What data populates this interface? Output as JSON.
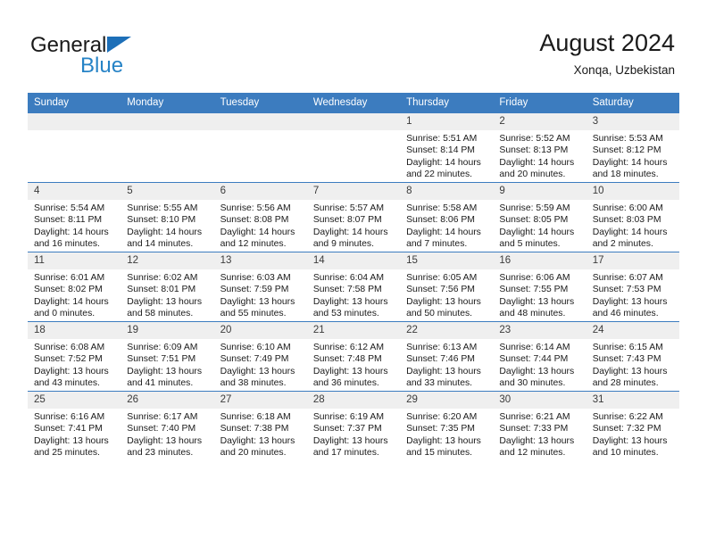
{
  "brand": {
    "name_part1": "General",
    "name_part2": "Blue",
    "accent_color": "#2683c6",
    "triangle_color": "#1d6fb8"
  },
  "header": {
    "title": "August 2024",
    "location": "Xonqa, Uzbekistan"
  },
  "theme": {
    "header_row_color": "#3c7cbf",
    "daynum_band_color": "#efefef",
    "text_color": "#1a1a1a"
  },
  "weekday_headers": [
    "Sunday",
    "Monday",
    "Tuesday",
    "Wednesday",
    "Thursday",
    "Friday",
    "Saturday"
  ],
  "weeks": [
    [
      {
        "day": "",
        "empty": true,
        "sunrise": "",
        "sunset": "",
        "daylight_line1": "",
        "daylight_line2": ""
      },
      {
        "day": "",
        "empty": true,
        "sunrise": "",
        "sunset": "",
        "daylight_line1": "",
        "daylight_line2": ""
      },
      {
        "day": "",
        "empty": true,
        "sunrise": "",
        "sunset": "",
        "daylight_line1": "",
        "daylight_line2": ""
      },
      {
        "day": "",
        "empty": true,
        "sunrise": "",
        "sunset": "",
        "daylight_line1": "",
        "daylight_line2": ""
      },
      {
        "day": "1",
        "empty": false,
        "sunrise": "Sunrise: 5:51 AM",
        "sunset": "Sunset: 8:14 PM",
        "daylight_line1": "Daylight: 14 hours",
        "daylight_line2": "and 22 minutes."
      },
      {
        "day": "2",
        "empty": false,
        "sunrise": "Sunrise: 5:52 AM",
        "sunset": "Sunset: 8:13 PM",
        "daylight_line1": "Daylight: 14 hours",
        "daylight_line2": "and 20 minutes."
      },
      {
        "day": "3",
        "empty": false,
        "sunrise": "Sunrise: 5:53 AM",
        "sunset": "Sunset: 8:12 PM",
        "daylight_line1": "Daylight: 14 hours",
        "daylight_line2": "and 18 minutes."
      }
    ],
    [
      {
        "day": "4",
        "empty": false,
        "sunrise": "Sunrise: 5:54 AM",
        "sunset": "Sunset: 8:11 PM",
        "daylight_line1": "Daylight: 14 hours",
        "daylight_line2": "and 16 minutes."
      },
      {
        "day": "5",
        "empty": false,
        "sunrise": "Sunrise: 5:55 AM",
        "sunset": "Sunset: 8:10 PM",
        "daylight_line1": "Daylight: 14 hours",
        "daylight_line2": "and 14 minutes."
      },
      {
        "day": "6",
        "empty": false,
        "sunrise": "Sunrise: 5:56 AM",
        "sunset": "Sunset: 8:08 PM",
        "daylight_line1": "Daylight: 14 hours",
        "daylight_line2": "and 12 minutes."
      },
      {
        "day": "7",
        "empty": false,
        "sunrise": "Sunrise: 5:57 AM",
        "sunset": "Sunset: 8:07 PM",
        "daylight_line1": "Daylight: 14 hours",
        "daylight_line2": "and 9 minutes."
      },
      {
        "day": "8",
        "empty": false,
        "sunrise": "Sunrise: 5:58 AM",
        "sunset": "Sunset: 8:06 PM",
        "daylight_line1": "Daylight: 14 hours",
        "daylight_line2": "and 7 minutes."
      },
      {
        "day": "9",
        "empty": false,
        "sunrise": "Sunrise: 5:59 AM",
        "sunset": "Sunset: 8:05 PM",
        "daylight_line1": "Daylight: 14 hours",
        "daylight_line2": "and 5 minutes."
      },
      {
        "day": "10",
        "empty": false,
        "sunrise": "Sunrise: 6:00 AM",
        "sunset": "Sunset: 8:03 PM",
        "daylight_line1": "Daylight: 14 hours",
        "daylight_line2": "and 2 minutes."
      }
    ],
    [
      {
        "day": "11",
        "empty": false,
        "sunrise": "Sunrise: 6:01 AM",
        "sunset": "Sunset: 8:02 PM",
        "daylight_line1": "Daylight: 14 hours",
        "daylight_line2": "and 0 minutes."
      },
      {
        "day": "12",
        "empty": false,
        "sunrise": "Sunrise: 6:02 AM",
        "sunset": "Sunset: 8:01 PM",
        "daylight_line1": "Daylight: 13 hours",
        "daylight_line2": "and 58 minutes."
      },
      {
        "day": "13",
        "empty": false,
        "sunrise": "Sunrise: 6:03 AM",
        "sunset": "Sunset: 7:59 PM",
        "daylight_line1": "Daylight: 13 hours",
        "daylight_line2": "and 55 minutes."
      },
      {
        "day": "14",
        "empty": false,
        "sunrise": "Sunrise: 6:04 AM",
        "sunset": "Sunset: 7:58 PM",
        "daylight_line1": "Daylight: 13 hours",
        "daylight_line2": "and 53 minutes."
      },
      {
        "day": "15",
        "empty": false,
        "sunrise": "Sunrise: 6:05 AM",
        "sunset": "Sunset: 7:56 PM",
        "daylight_line1": "Daylight: 13 hours",
        "daylight_line2": "and 50 minutes."
      },
      {
        "day": "16",
        "empty": false,
        "sunrise": "Sunrise: 6:06 AM",
        "sunset": "Sunset: 7:55 PM",
        "daylight_line1": "Daylight: 13 hours",
        "daylight_line2": "and 48 minutes."
      },
      {
        "day": "17",
        "empty": false,
        "sunrise": "Sunrise: 6:07 AM",
        "sunset": "Sunset: 7:53 PM",
        "daylight_line1": "Daylight: 13 hours",
        "daylight_line2": "and 46 minutes."
      }
    ],
    [
      {
        "day": "18",
        "empty": false,
        "sunrise": "Sunrise: 6:08 AM",
        "sunset": "Sunset: 7:52 PM",
        "daylight_line1": "Daylight: 13 hours",
        "daylight_line2": "and 43 minutes."
      },
      {
        "day": "19",
        "empty": false,
        "sunrise": "Sunrise: 6:09 AM",
        "sunset": "Sunset: 7:51 PM",
        "daylight_line1": "Daylight: 13 hours",
        "daylight_line2": "and 41 minutes."
      },
      {
        "day": "20",
        "empty": false,
        "sunrise": "Sunrise: 6:10 AM",
        "sunset": "Sunset: 7:49 PM",
        "daylight_line1": "Daylight: 13 hours",
        "daylight_line2": "and 38 minutes."
      },
      {
        "day": "21",
        "empty": false,
        "sunrise": "Sunrise: 6:12 AM",
        "sunset": "Sunset: 7:48 PM",
        "daylight_line1": "Daylight: 13 hours",
        "daylight_line2": "and 36 minutes."
      },
      {
        "day": "22",
        "empty": false,
        "sunrise": "Sunrise: 6:13 AM",
        "sunset": "Sunset: 7:46 PM",
        "daylight_line1": "Daylight: 13 hours",
        "daylight_line2": "and 33 minutes."
      },
      {
        "day": "23",
        "empty": false,
        "sunrise": "Sunrise: 6:14 AM",
        "sunset": "Sunset: 7:44 PM",
        "daylight_line1": "Daylight: 13 hours",
        "daylight_line2": "and 30 minutes."
      },
      {
        "day": "24",
        "empty": false,
        "sunrise": "Sunrise: 6:15 AM",
        "sunset": "Sunset: 7:43 PM",
        "daylight_line1": "Daylight: 13 hours",
        "daylight_line2": "and 28 minutes."
      }
    ],
    [
      {
        "day": "25",
        "empty": false,
        "sunrise": "Sunrise: 6:16 AM",
        "sunset": "Sunset: 7:41 PM",
        "daylight_line1": "Daylight: 13 hours",
        "daylight_line2": "and 25 minutes."
      },
      {
        "day": "26",
        "empty": false,
        "sunrise": "Sunrise: 6:17 AM",
        "sunset": "Sunset: 7:40 PM",
        "daylight_line1": "Daylight: 13 hours",
        "daylight_line2": "and 23 minutes."
      },
      {
        "day": "27",
        "empty": false,
        "sunrise": "Sunrise: 6:18 AM",
        "sunset": "Sunset: 7:38 PM",
        "daylight_line1": "Daylight: 13 hours",
        "daylight_line2": "and 20 minutes."
      },
      {
        "day": "28",
        "empty": false,
        "sunrise": "Sunrise: 6:19 AM",
        "sunset": "Sunset: 7:37 PM",
        "daylight_line1": "Daylight: 13 hours",
        "daylight_line2": "and 17 minutes."
      },
      {
        "day": "29",
        "empty": false,
        "sunrise": "Sunrise: 6:20 AM",
        "sunset": "Sunset: 7:35 PM",
        "daylight_line1": "Daylight: 13 hours",
        "daylight_line2": "and 15 minutes."
      },
      {
        "day": "30",
        "empty": false,
        "sunrise": "Sunrise: 6:21 AM",
        "sunset": "Sunset: 7:33 PM",
        "daylight_line1": "Daylight: 13 hours",
        "daylight_line2": "and 12 minutes."
      },
      {
        "day": "31",
        "empty": false,
        "sunrise": "Sunrise: 6:22 AM",
        "sunset": "Sunset: 7:32 PM",
        "daylight_line1": "Daylight: 13 hours",
        "daylight_line2": "and 10 minutes."
      }
    ]
  ]
}
